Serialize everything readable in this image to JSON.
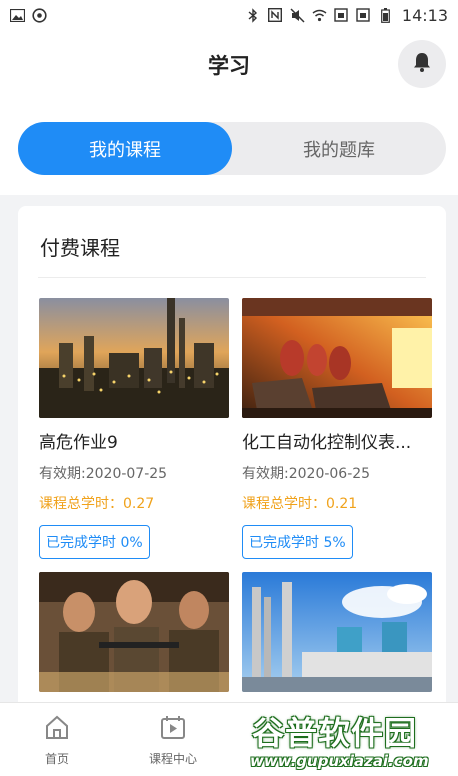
{
  "status_bar": {
    "time": "14:13"
  },
  "header": {
    "title": "学习"
  },
  "tabs": [
    {
      "label": "我的课程",
      "active": true
    },
    {
      "label": "我的题库",
      "active": false
    }
  ],
  "section": {
    "title": "付费课程"
  },
  "courses": [
    {
      "name": "高危作业9",
      "valid": "有效期:2020-07-25",
      "hours": "课程总学时：0.27",
      "progress": "已完成学时 0%"
    },
    {
      "name": "化工自动化控制仪表...",
      "valid": "有效期:2020-06-25",
      "hours": "课程总学时：0.21",
      "progress": "已完成学时 5%"
    },
    {
      "name": "",
      "valid": "",
      "hours": "",
      "progress": ""
    },
    {
      "name": "",
      "valid": "",
      "hours": "",
      "progress": ""
    }
  ],
  "bottom_nav": [
    {
      "label": "首页",
      "icon": "home-icon"
    },
    {
      "label": "课程中心",
      "icon": "play-calendar-icon"
    }
  ],
  "watermark": {
    "title": "谷普软件园",
    "url": "www.gupuxiazai.com"
  },
  "colors": {
    "accent": "#1f8cf6",
    "hours": "#f0a21b",
    "background": "#f2f3f5"
  }
}
